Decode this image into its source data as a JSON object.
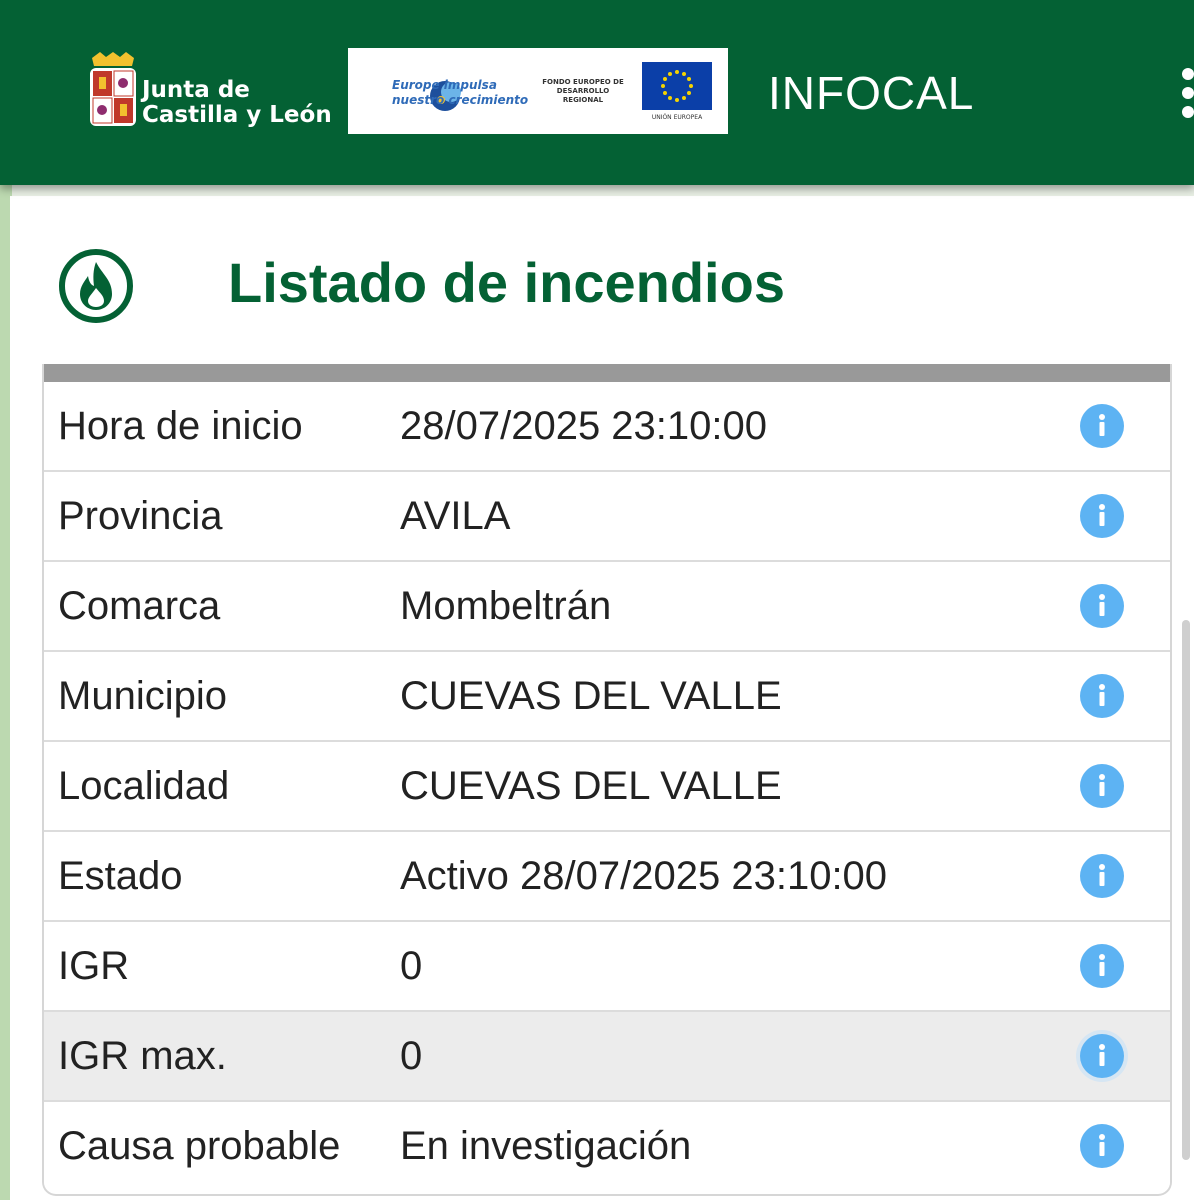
{
  "header": {
    "org_line1": "Junta de",
    "org_line2": "Castilla y León",
    "eu_slogan_line1": "Europe impulsa",
    "eu_slogan_line2": "nuestro crecimiento",
    "eu_fund_text": "FONDO EUROPEO DE DESARROLLO REGIONAL",
    "eu_label": "UNIÓN EUROPEA",
    "app_title": "INFOCAL",
    "brand_color": "#046134"
  },
  "panel": {
    "title": "Listado de incendios",
    "icon": "flame-icon"
  },
  "rows": [
    {
      "label": "Hora de inicio",
      "value": "28/07/2025 23:10:00"
    },
    {
      "label": "Provincia",
      "value": "AVILA"
    },
    {
      "label": "Comarca",
      "value": "Mombeltrán"
    },
    {
      "label": "Municipio",
      "value": "CUEVAS DEL VALLE"
    },
    {
      "label": "Localidad",
      "value": "CUEVAS DEL VALLE"
    },
    {
      "label": "Estado",
      "value": "Activo 28/07/2025 23:10:00"
    },
    {
      "label": "IGR",
      "value": "0"
    },
    {
      "label": "IGR max.",
      "value": "0"
    },
    {
      "label": "Causa probable",
      "value": "En investigación"
    }
  ],
  "info_icon": "info-icon",
  "info_color": "#5db3f3"
}
